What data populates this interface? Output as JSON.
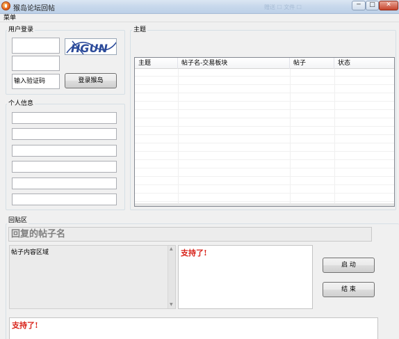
{
  "window": {
    "title": "猴岛论坛回帖",
    "title_right_blur": "赠送 ☐ 文件 ☐",
    "buttons": {
      "minimize": "─",
      "maximize": "□",
      "close": "✕"
    },
    "icon": "app-icon"
  },
  "menu": {
    "items": [
      "菜单"
    ]
  },
  "login": {
    "group_title": "用户登录",
    "username_value": "",
    "password_value": "",
    "captcha_input_value": "输入验证码",
    "captcha_text": "HGUN",
    "login_button": "登录猴岛"
  },
  "personal": {
    "group_title": "个人信息",
    "fields": [
      "",
      "",
      "",
      "",
      "",
      ""
    ]
  },
  "subject": {
    "group_title": "主题",
    "columns": [
      "主题",
      "帖子名-交易板块",
      "帖子",
      "状态"
    ],
    "rows": []
  },
  "reply": {
    "group_title": "回贴区",
    "subject_placeholder": "回复的帖子名",
    "content_label": "帖子内容区域",
    "reply_text_1": "支持了!",
    "reply_text_2": "支持了!",
    "start_button": "启 动",
    "end_button": "结 束"
  },
  "colors": {
    "reply_text": "#d8231a",
    "placeholder_text": "#7f7f7f"
  }
}
